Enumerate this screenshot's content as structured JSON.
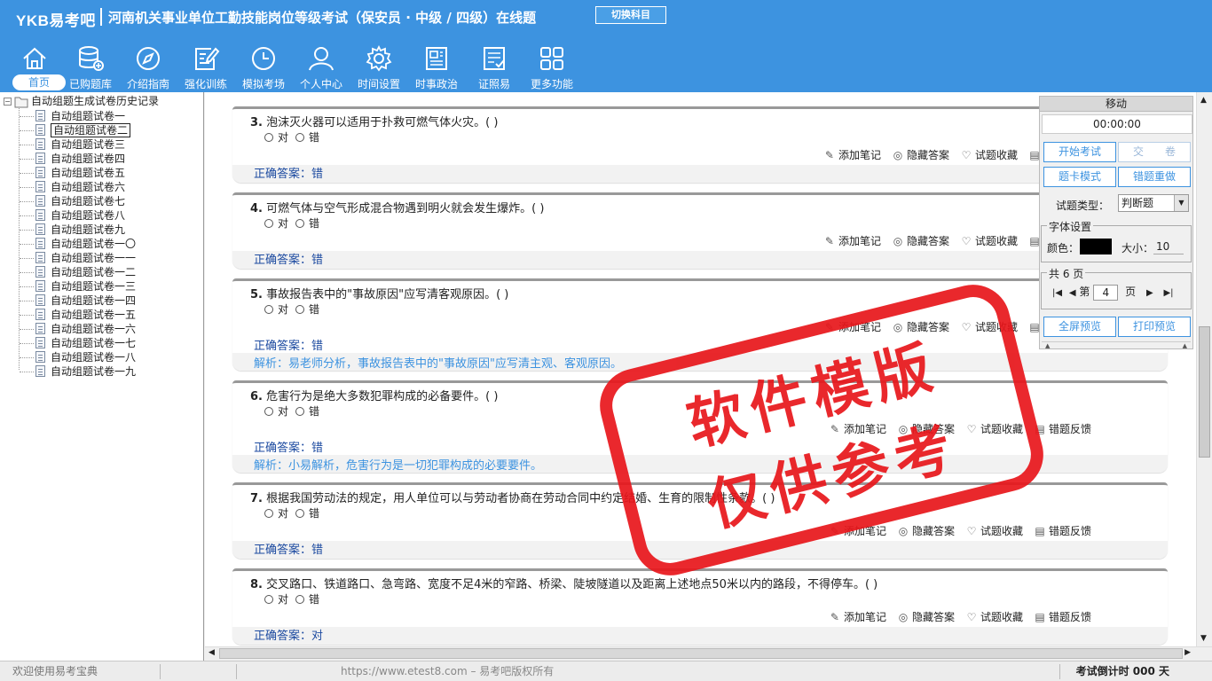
{
  "header": {
    "logo": "YKB易考吧",
    "title": "河南机关事业单位工勤技能岗位等级考试（保安员 · 中级 / 四级）在线题",
    "switch_label": "切换科目"
  },
  "nav": [
    {
      "label": "首页",
      "icon": "home-icon"
    },
    {
      "label": "已购题库",
      "icon": "database-icon"
    },
    {
      "label": "介绍指南",
      "icon": "compass-icon"
    },
    {
      "label": "强化训练",
      "icon": "edit-icon"
    },
    {
      "label": "模拟考场",
      "icon": "clock-icon"
    },
    {
      "label": "个人中心",
      "icon": "user-icon"
    },
    {
      "label": "时间设置",
      "icon": "gear-icon"
    },
    {
      "label": "时事政治",
      "icon": "news-icon"
    },
    {
      "label": "证照易",
      "icon": "certificate-icon"
    },
    {
      "label": "更多功能",
      "icon": "grid-icon"
    }
  ],
  "sidebar": {
    "root": "自动组题生成试卷历史记录",
    "items": [
      "自动组题试卷一",
      "自动组题试卷二",
      "自动组题试卷三",
      "自动组题试卷四",
      "自动组题试卷五",
      "自动组题试卷六",
      "自动组题试卷七",
      "自动组题试卷八",
      "自动组题试卷九",
      "自动组题试卷一〇",
      "自动组题试卷一一",
      "自动组题试卷一二",
      "自动组题试卷一三",
      "自动组题试卷一四",
      "自动组题试卷一五",
      "自动组题试卷一六",
      "自动组题试卷一七",
      "自动组题试卷一八",
      "自动组题试卷一九"
    ],
    "selected_index": 1
  },
  "options": {
    "a": "对",
    "b": "错"
  },
  "actions": {
    "note": "添加笔记",
    "hide": "隐藏答案",
    "fav": "试题收藏",
    "feedback": "错题反馈",
    "feedback_short": "错"
  },
  "questions": [
    {
      "num": "3.",
      "text": "泡沫灭火器可以适用于扑救可燃气体火灾。( )",
      "answer": "正确答案：错",
      "analysis": ""
    },
    {
      "num": "4.",
      "text": "可燃气体与空气形成混合物遇到明火就会发生爆炸。( )",
      "answer": "正确答案：错",
      "analysis": ""
    },
    {
      "num": "5.",
      "text": "事故报告表中的\"事故原因\"应写清客观原因。( )",
      "answer": "正确答案：错",
      "analysis": "解析：易老师分析，事故报告表中的\"事故原因\"应写清主观、客观原因。"
    },
    {
      "num": "6.",
      "text": "危害行为是绝大多数犯罪构成的必备要件。( )",
      "answer": "正确答案：错",
      "analysis": "解析：小易解析，危害行为是一切犯罪构成的必要要件。"
    },
    {
      "num": "7.",
      "text": "根据我国劳动法的规定，用人单位可以与劳动者协商在劳动合同中约定结婚、生育的限制性条款。( )",
      "answer": "正确答案：错",
      "analysis": ""
    },
    {
      "num": "8.",
      "text": "交叉路口、铁道路口、急弯路、宽度不足4米的窄路、桥梁、陡坡隧道以及距离上述地点50米以内的路段，不得停车。( )",
      "answer": "正确答案：对",
      "analysis": ""
    }
  ],
  "panel": {
    "title": "移动",
    "timer": "00:00:00",
    "start_exam": "开始考试",
    "submit": "交　　卷",
    "card_mode": "题卡模式",
    "redo_wrong": "错题重做",
    "type_label": "试题类型：",
    "type_value": "判断题",
    "font_legend": "字体设置",
    "color_label": "颜色：",
    "color_value": "#000000",
    "size_label": "大小：",
    "size_value": "10",
    "pages_legend": "共 6 页",
    "page_prefix": "第",
    "page_value": "4",
    "page_suffix": "页",
    "fullscreen": "全屏预览",
    "print": "打印预览"
  },
  "watermark": {
    "line1": "软件模版",
    "line2": "仅供参考"
  },
  "status": {
    "welcome": "欢迎使用易考宝典",
    "url": "https://www.etest8.com – 易考吧版权所有",
    "countdown": "考试倒计时 000 天"
  },
  "colors": {
    "header_bg": "#3d93e0",
    "stamp": "#e8161b",
    "answer": "#1c4aa0",
    "analysis": "#3d93e0"
  }
}
